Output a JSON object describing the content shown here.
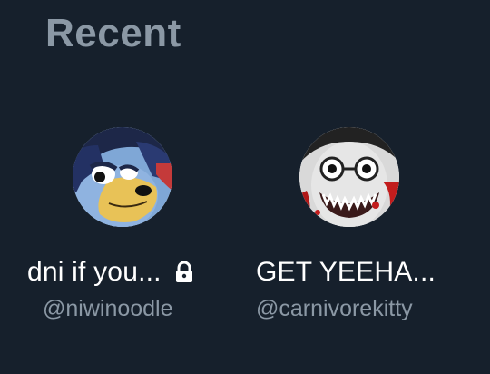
{
  "section": {
    "title": "Recent"
  },
  "accounts": [
    {
      "display_name": "dni if you...",
      "handle": "@niwinoodle",
      "protected": true,
      "avatar_icon": "cartoon-dog-avatar"
    },
    {
      "display_name": "GET YEEHA...",
      "handle": "@carnivorekitty",
      "protected": false,
      "avatar_icon": "horror-face-avatar"
    }
  ],
  "colors": {
    "background": "#16202c",
    "title": "#8b98a5",
    "name": "#ffffff",
    "handle": "#8b98a5"
  }
}
